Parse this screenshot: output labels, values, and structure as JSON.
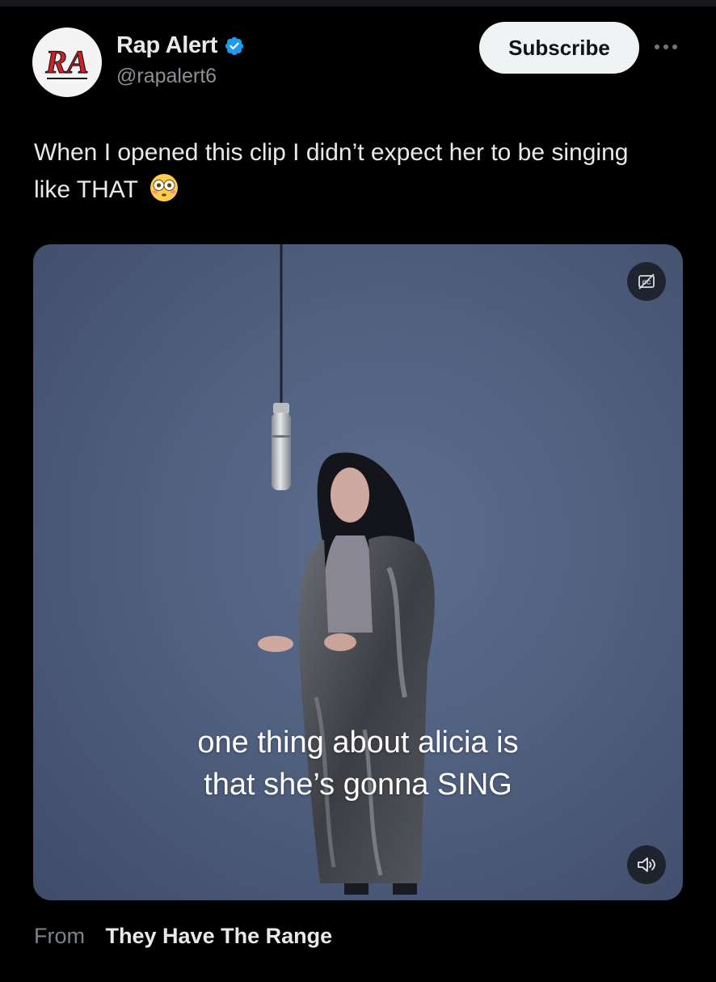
{
  "account": {
    "name": "Rap Alert",
    "handle": "@rapalert6",
    "avatar_text": "RA",
    "verified": true
  },
  "actions": {
    "subscribe_label": "Subscribe",
    "more_icon": "more-horizontal-icon"
  },
  "tweet": {
    "text": "When I opened this clip I didn’t expect her to be singing like THAT",
    "emoji": "flushed-face-emoji"
  },
  "video": {
    "caption_line1": "one thing about alicia is",
    "caption_line2": "that she’s gonna SING",
    "cc_icon": "closed-captions-icon",
    "volume_icon": "volume-icon"
  },
  "source": {
    "from_label": "From",
    "name": "They Have The Range"
  },
  "colors": {
    "background": "#000000",
    "verified_blue": "#1d9bf0",
    "subscribe_bg": "#eff3f4",
    "video_bg": "#55658a"
  }
}
